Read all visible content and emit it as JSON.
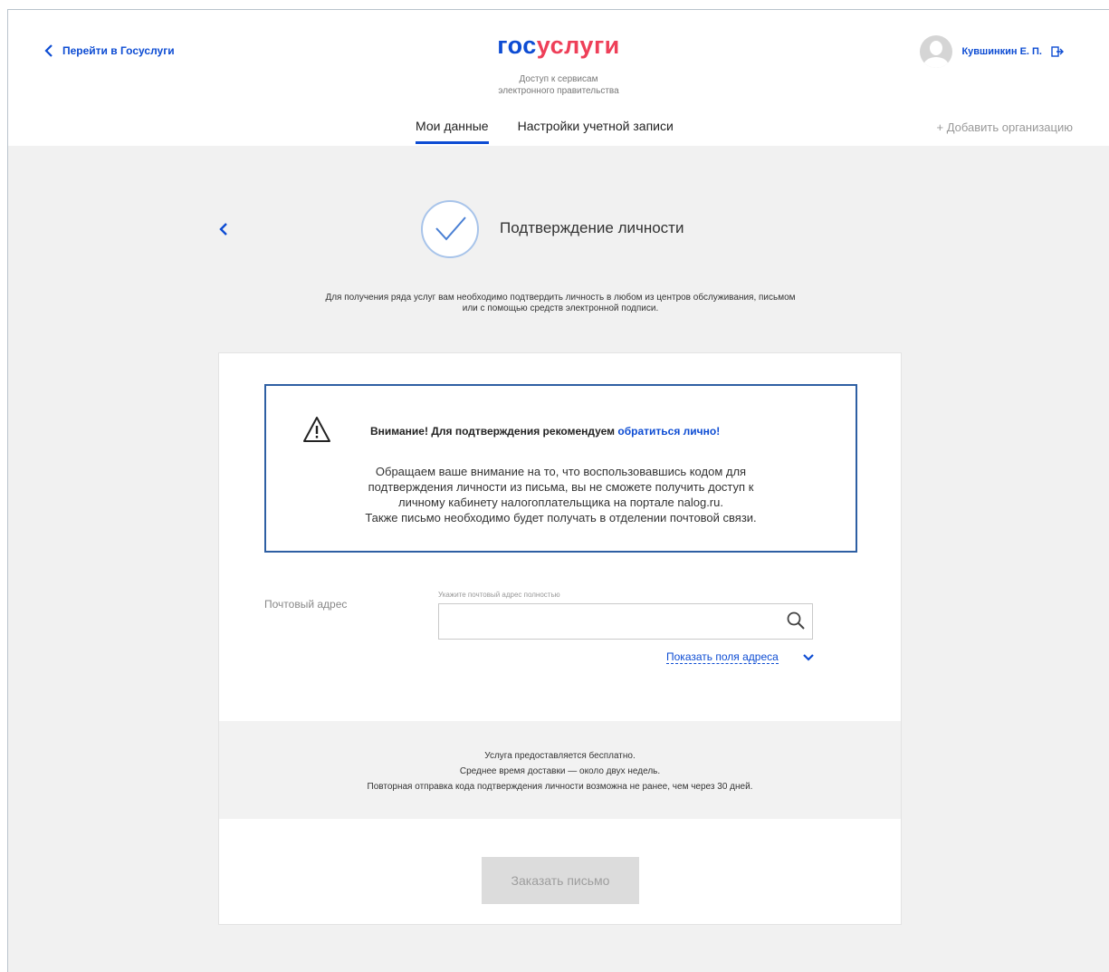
{
  "header": {
    "back_link": "Перейти в Госуслуги",
    "logo_part1": "гос",
    "logo_part2": "услуги",
    "logo_subtitle_line1": "Доступ к сервисам",
    "logo_subtitle_line2": "электронного правительства",
    "user_name": "Кувшинкин Е. П.",
    "tabs": [
      {
        "label": "Мои данные",
        "active": true
      },
      {
        "label": "Настройки учетной записи",
        "active": false
      }
    ],
    "add_org": "+ Добавить организацию"
  },
  "page": {
    "title": "Подтверждение личности",
    "intro_line1": "Для получения ряда услуг вам необходимо подтвердить личность в любом из центров обслуживания, письмом",
    "intro_line2": "или с помощью средств электронной подписи."
  },
  "alert": {
    "head_text": "Внимание! Для подтверждения рекомендуем ",
    "head_link": "обратиться лично!",
    "body_line1": "Обращаем ваше внимание на то, что воспользовавшись кодом для",
    "body_line2": "подтверждения личности из письма, вы не сможете получить доступ к",
    "body_line3": "личному кабинету налогоплательщика на портале nalog.ru.",
    "body_line4": "Также письмо необходимо будет получать в отделении почтовой связи."
  },
  "address": {
    "label": "Почтовый адрес",
    "hint": "Укажите почтовый адрес полностью",
    "value": "",
    "show_fields": "Показать поля адреса"
  },
  "info": {
    "line1": "Услуга предоставляется бесплатно.",
    "line2": "Среднее время доставки — около двух недель.",
    "line3": "Повторная отправка кода подтверждения личности возможна не ранее, чем через 30 дней."
  },
  "order_button": "Заказать письмо",
  "colors": {
    "brand_blue": "#0d4cd3",
    "brand_red": "#ee3f58",
    "alert_border": "#2e5fa3"
  }
}
